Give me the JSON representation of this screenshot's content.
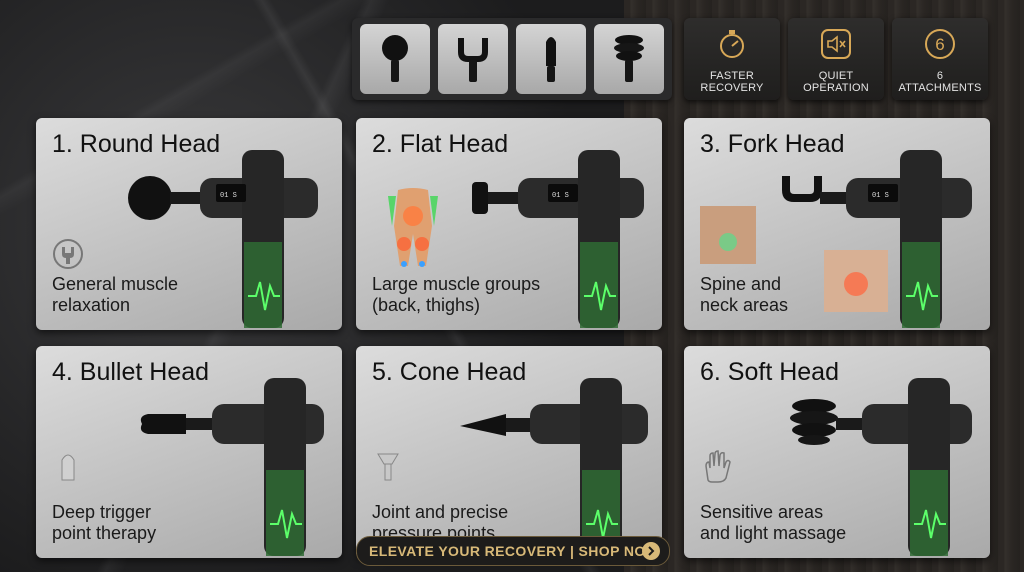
{
  "attachments_strip": {
    "items": [
      "round-head",
      "fork-head",
      "bullet-head",
      "soft-head"
    ]
  },
  "features": [
    {
      "label": "FASTER\nRECOVERY",
      "icon": "stopwatch-icon"
    },
    {
      "label": "QUIET\nOPERATION",
      "icon": "speaker-mute-icon"
    },
    {
      "label": "6\nATTACHMENTS",
      "icon": "number-six-icon"
    }
  ],
  "cards": [
    {
      "title": "1. Round Head",
      "desc": "General muscle\nrelaxation",
      "icon": "wrench-icon"
    },
    {
      "title": "2. Flat Head",
      "desc": "Large muscle groups\n(back, thighs)",
      "icon": "body-muscle-map"
    },
    {
      "title": "3. Fork Head",
      "desc": "Spine and\nneck areas",
      "icon": "neck-spine-image"
    },
    {
      "title": "4. Bullet Head",
      "desc": "Deep trigger\npoint therapy",
      "icon": "bullet-attachment-icon"
    },
    {
      "title": "5. Cone Head",
      "desc": "Joint and precise\npressure points",
      "icon": "cone-attachment-icon"
    },
    {
      "title": "6. Soft Head",
      "desc": "Sensitive areas\nand light massage",
      "icon": "hand-icon"
    }
  ],
  "display": {
    "left": "01",
    "right": "S"
  },
  "cta": {
    "label": "ELEVATE YOUR RECOVERY | SHOP NOW"
  },
  "colors": {
    "accent": "#d8b978",
    "glow": "#37e24b",
    "card": "#c8c8c8"
  }
}
